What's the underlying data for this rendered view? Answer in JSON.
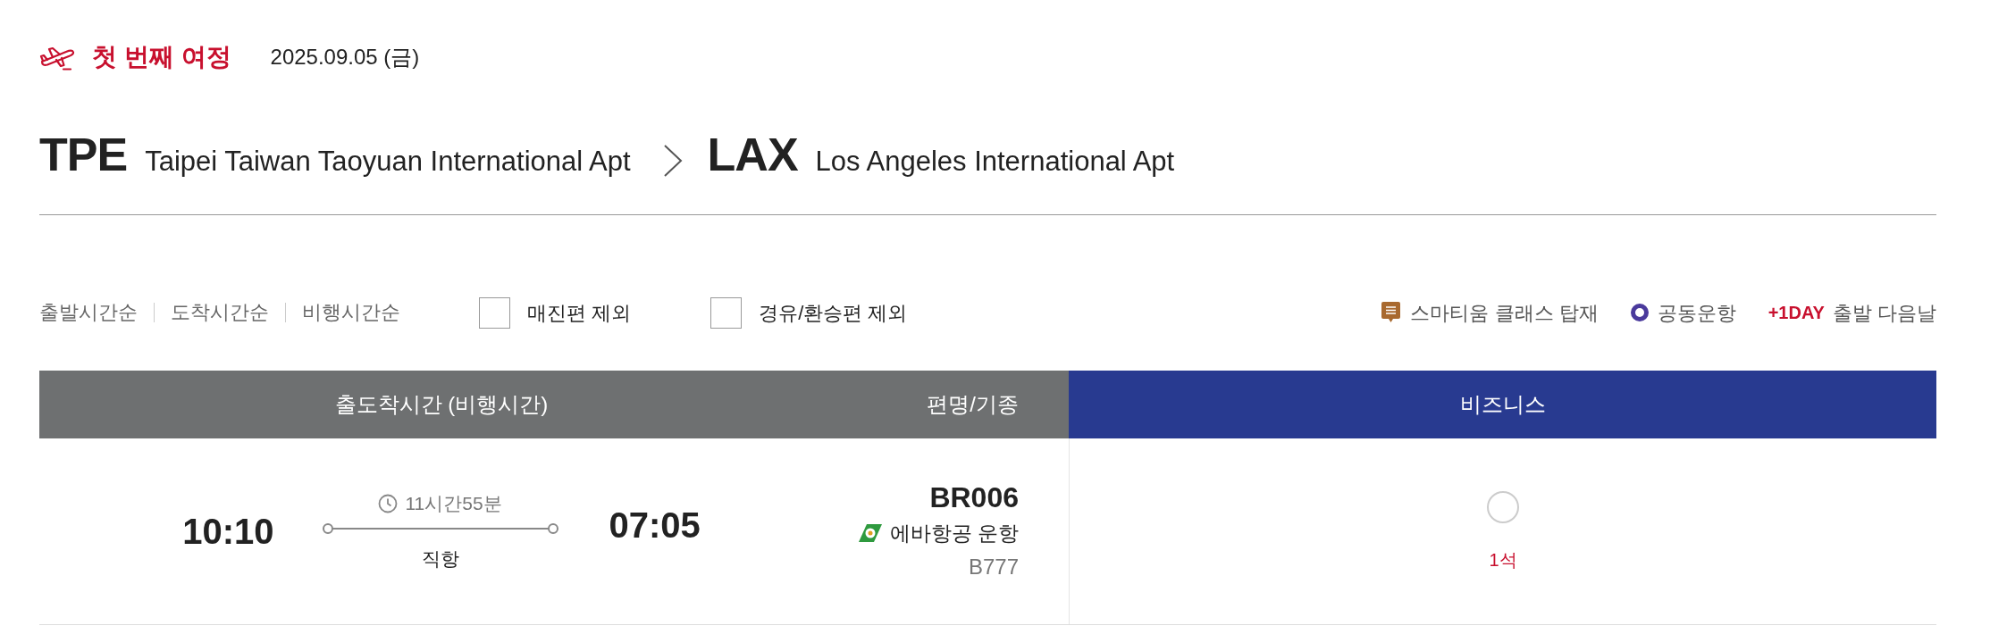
{
  "journey": {
    "title": "첫 번째 여정",
    "date": "2025.09.05 (금)"
  },
  "route": {
    "origin": {
      "code": "TPE",
      "name": "Taipei Taiwan Taoyuan International Apt"
    },
    "destination": {
      "code": "LAX",
      "name": "Los Angeles International Apt"
    }
  },
  "sort_options": [
    {
      "label": "출발시간순",
      "selected": false
    },
    {
      "label": "도착시간순",
      "selected": false
    },
    {
      "label": "비행시간순",
      "selected": false
    }
  ],
  "filters": [
    {
      "label": "매진편 제외",
      "checked": false
    },
    {
      "label": "경유/환승편 제외",
      "checked": false
    }
  ],
  "legend": [
    {
      "kind": "smartium",
      "label": "스마티움 클래스 탑재"
    },
    {
      "kind": "codeshare",
      "label": "공동운항"
    },
    {
      "kind": "next_day",
      "tag": "+1DAY",
      "label": "출발 다음날"
    }
  ],
  "table": {
    "columns": [
      {
        "label": "출도착시간 (비행시간)",
        "kind": "schedule"
      },
      {
        "label": "편명/기종",
        "kind": "flight"
      },
      {
        "label": "비즈니스",
        "kind": "cabin"
      }
    ],
    "rows": [
      {
        "departure": "10:10",
        "duration": "11시간55분",
        "stops": "직항",
        "arrival": "07:05",
        "flight": "BR006",
        "operator": "에바항공 운항",
        "aircraft": "B777",
        "fares": [
          {
            "selected": false,
            "seats": "1석"
          }
        ]
      }
    ]
  }
}
